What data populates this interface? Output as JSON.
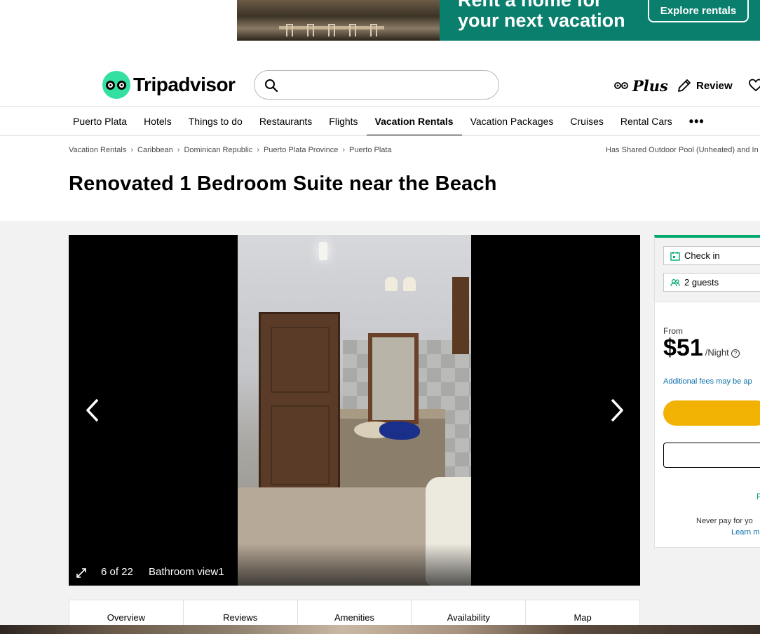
{
  "ad": {
    "headline_line1": "Rent a home for",
    "headline_line2": "your next vacation",
    "button_label": "Explore rentals"
  },
  "header": {
    "logo_text": "Tripadvisor",
    "search_placeholder": "",
    "plus_label": "Plus",
    "review_label": "Review"
  },
  "nav": {
    "items": [
      {
        "label": "Puerto Plata"
      },
      {
        "label": "Hotels"
      },
      {
        "label": "Things to do"
      },
      {
        "label": "Restaurants"
      },
      {
        "label": "Flights"
      },
      {
        "label": "Vacation Rentals"
      },
      {
        "label": "Vacation Packages"
      },
      {
        "label": "Cruises"
      },
      {
        "label": "Rental Cars"
      }
    ],
    "active": "Vacation Rentals",
    "more_label": "•••"
  },
  "breadcrumbs": [
    "Vacation Rentals",
    "Caribbean",
    "Dominican Republic",
    "Puerto Plata Province",
    "Puerto Plata"
  ],
  "breadcrumb_right": "Has Shared Outdoor Pool (Unheated) and In",
  "listing": {
    "title": "Renovated 1 Bedroom Suite near the Beach"
  },
  "gallery": {
    "counter": "6 of 22",
    "caption": "Bathroom view1"
  },
  "tabs": [
    "Overview",
    "Reviews",
    "Amenities",
    "Availability",
    "Map"
  ],
  "booking": {
    "check_in": "Check in",
    "guests": "2 guests",
    "from_label": "From",
    "price": "$51",
    "per_night": "/Night",
    "help_glyph": "?",
    "fees_note": "Additional fees may be ap",
    "green_partial": "P",
    "never_pay": "Never pay for yo",
    "learn_more": "Learn m"
  },
  "colors": {
    "brand_green": "#34e0a1",
    "accent_green": "#00aa6c",
    "cta_yellow": "#f2b203",
    "link_blue": "#0a6fa8"
  }
}
